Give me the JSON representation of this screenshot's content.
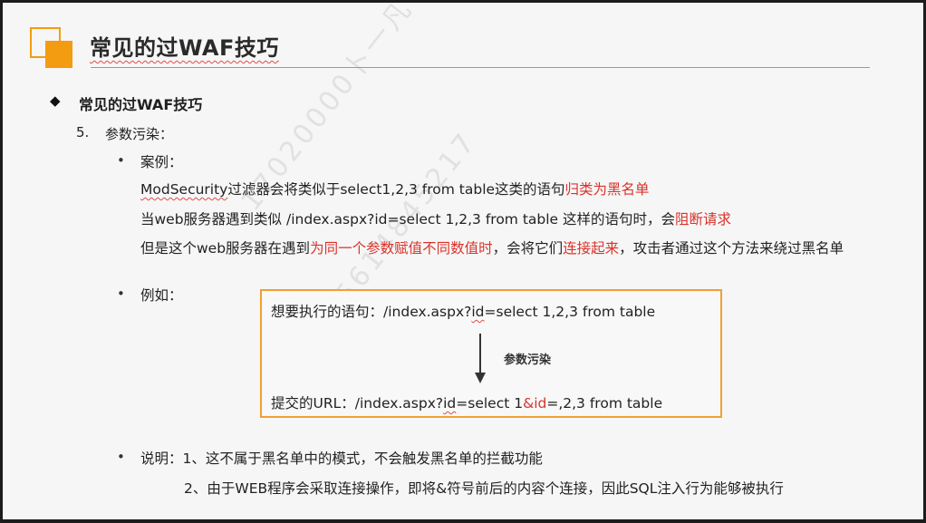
{
  "slide": {
    "title": "常见的过WAF技巧",
    "section_title": "常见的过WAF技巧",
    "item_number": "5.",
    "item_label": "参数污染：",
    "case_label": "案例：",
    "case_line1_a": "ModSecurity",
    "case_line1_b": "过滤器会将类似于select1,2,3 from table这类的语句",
    "case_line1_red": "归类为黑名单",
    "case_line2_a": "当web服务器遇到类似 /index.aspx?id=select 1,2,3 from table 这样的语句时，会",
    "case_line2_red": "阻断请求",
    "case_line3_a": "但是这个web服务器在遇到",
    "case_line3_red1": "为同一个参数赋值不同数值时",
    "case_line3_b": "，会将它们",
    "case_line3_red2": "连接起来",
    "case_line3_c": "，攻击者通过这个方法来绕过黑名单",
    "example_label": "例如：",
    "box_line1_a": "想要执行的语句：/index.aspx?",
    "box_line1_b": "id",
    "box_line1_c": "=select 1,2,3 from table",
    "arrow_label": "参数污染",
    "box_line2_a": "提交的URL：/index.aspx?",
    "box_line2_b": "id",
    "box_line2_c": "=select 1",
    "box_line2_red": "&id",
    "box_line2_d": "=,2,3 from table",
    "note_label": "说明：1、这不属于黑名单中的模式，不会触发黑名单的拦截功能",
    "note_line2": "2、由于WEB程序会采取连接操作，即将&符号前后的内容个连接，因此SQL注入行为能够被执行",
    "watermark1": "17020000卜一凡",
    "watermark2": "+8615614845217"
  },
  "icons": {
    "bullet_diamond": "◆",
    "bullet_dot": "•"
  },
  "colors": {
    "accent": "#f39c12",
    "highlight_red": "#d9332b",
    "box_border": "#f0a030"
  }
}
